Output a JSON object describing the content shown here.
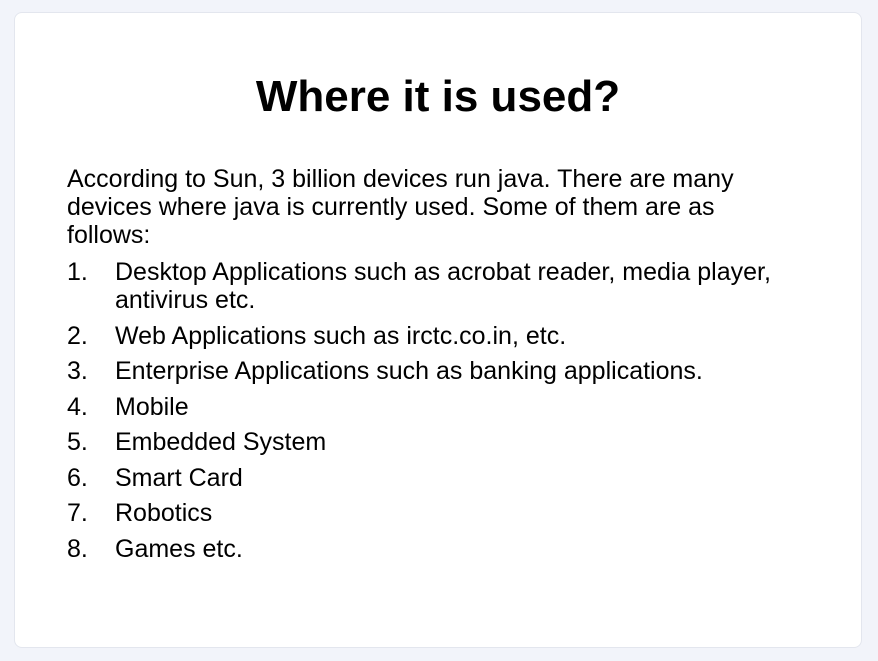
{
  "slide": {
    "title": "Where it is used?",
    "intro": "According to Sun, 3 billion devices run java. There are many devices where java is currently used. Some of them are as follows:",
    "items": [
      {
        "num": "1.",
        "text": "Desktop Applications such as acrobat reader, media player, antivirus etc."
      },
      {
        "num": "2.",
        "text": "Web Applications such as irctc.co.in,  etc."
      },
      {
        "num": "3.",
        "text": "Enterprise Applications such as banking applications."
      },
      {
        "num": "4.",
        "text": "Mobile"
      },
      {
        "num": "5.",
        "text": "Embedded System"
      },
      {
        "num": "6.",
        "text": "Smart Card"
      },
      {
        "num": "7.",
        "text": "Robotics"
      },
      {
        "num": "8.",
        "text": "Games etc."
      }
    ]
  }
}
